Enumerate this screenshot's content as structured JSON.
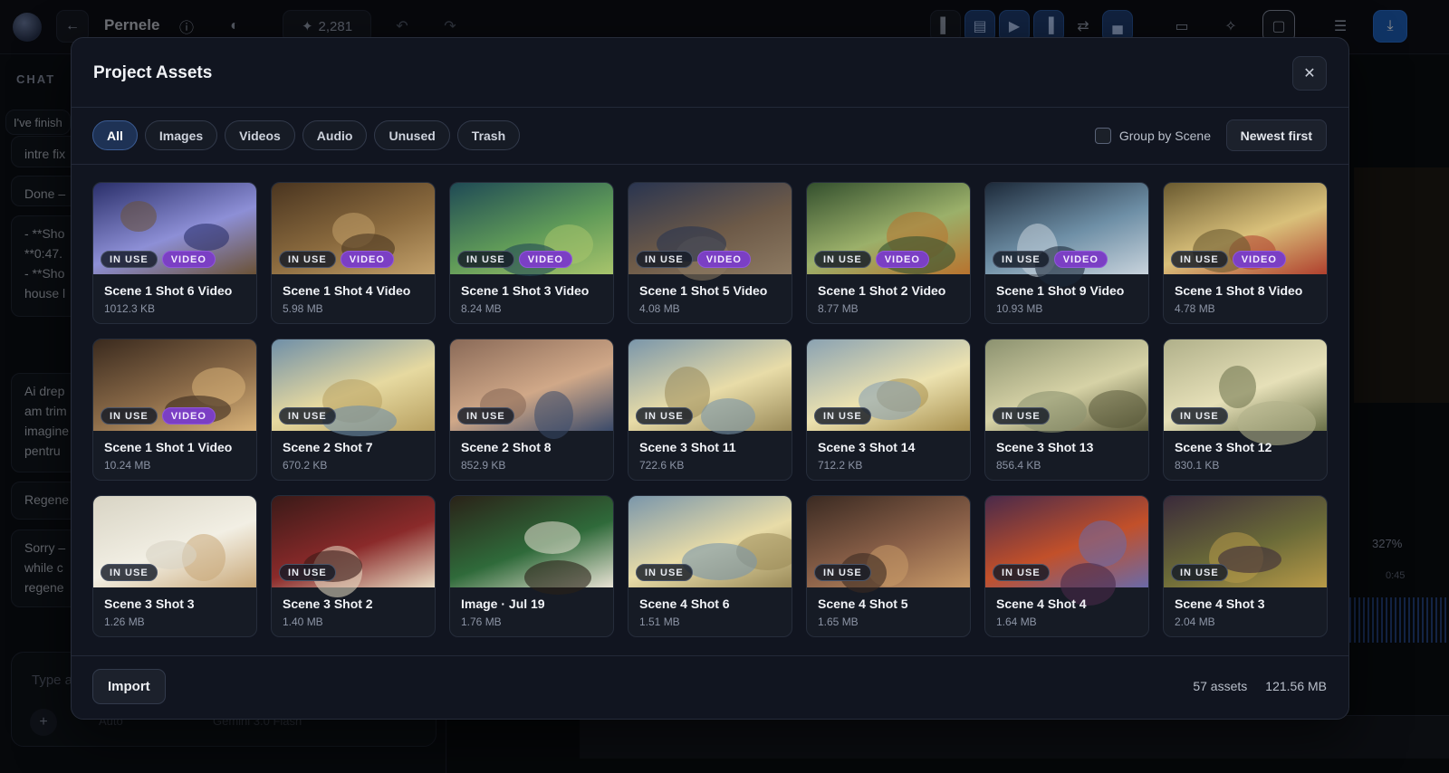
{
  "app": {
    "title": "Pernele",
    "credits": "2,281",
    "chat_label": "CHAT",
    "chat_messages": [
      "I've finish",
      "intre fix",
      "Done –",
      "- **Sho\n**0:47.\n- **Sho\nhouse l",
      "Ai drep\nam trim\nimagine\npentru",
      "Regene",
      "Sorry –\nwhile c\nregene"
    ],
    "chat_input_placeholder": "Type a",
    "model_label": "Gemini 3.0 Flash",
    "auto_label": "Auto",
    "zoom_label": "327%",
    "time_label": "0:45"
  },
  "modal": {
    "title": "Project Assets",
    "close_label": "✕",
    "filters": [
      "All",
      "Images",
      "Videos",
      "Audio",
      "Unused",
      "Trash"
    ],
    "active_filter": "All",
    "group_by_label": "Group by Scene",
    "sort_label": "Newest first",
    "import_label": "Import",
    "asset_count": "57 assets",
    "total_size": "121.56 MB",
    "badge_in_use": "IN USE",
    "badge_video": "VIDEO"
  },
  "assets": [
    {
      "name": "Scene 1 Shot 6 Video",
      "size": "1012.3 KB",
      "in_use": true,
      "video": true,
      "colors": [
        "#2a2f6a",
        "#8d8fd6",
        "#6b5236"
      ]
    },
    {
      "name": "Scene 1 Shot 4 Video",
      "size": "5.98 MB",
      "in_use": true,
      "video": true,
      "colors": [
        "#4a3520",
        "#8a6a3e",
        "#c2a06a"
      ]
    },
    {
      "name": "Scene 1 Shot 3 Video",
      "size": "8.24 MB",
      "in_use": true,
      "video": true,
      "colors": [
        "#1f4a55",
        "#5f9a58",
        "#a8c46c"
      ]
    },
    {
      "name": "Scene 1 Shot 5 Video",
      "size": "4.08 MB",
      "in_use": true,
      "video": true,
      "colors": [
        "#2a3550",
        "#6d5a48",
        "#8d7a62"
      ]
    },
    {
      "name": "Scene 1 Shot 2 Video",
      "size": "8.77 MB",
      "in_use": true,
      "video": true,
      "colors": [
        "#34502e",
        "#9bb06a",
        "#b8732e"
      ]
    },
    {
      "name": "Scene 1 Shot 9 Video",
      "size": "10.93 MB",
      "in_use": true,
      "video": true,
      "colors": [
        "#1d2a3a",
        "#6e8fa6",
        "#c8d3dc"
      ]
    },
    {
      "name": "Scene 1 Shot 8 Video",
      "size": "4.78 MB",
      "in_use": true,
      "video": true,
      "colors": [
        "#6a5a30",
        "#d9c07a",
        "#b0402e"
      ]
    },
    {
      "name": "Scene 1 Shot 1 Video",
      "size": "10.24 MB",
      "in_use": true,
      "video": true,
      "colors": [
        "#3a2a1e",
        "#8a6a48",
        "#d8b278"
      ]
    },
    {
      "name": "Scene 2 Shot 7",
      "size": "670.2 KB",
      "in_use": true,
      "video": false,
      "colors": [
        "#6f8fa8",
        "#e6d9a0",
        "#b8a060"
      ]
    },
    {
      "name": "Scene 2 Shot 8",
      "size": "852.9 KB",
      "in_use": true,
      "video": false,
      "colors": [
        "#8a6a58",
        "#d0a888",
        "#3a4a6a"
      ]
    },
    {
      "name": "Scene 3 Shot 11",
      "size": "722.6 KB",
      "in_use": true,
      "video": false,
      "colors": [
        "#7a96aa",
        "#e8dca8",
        "#9a8a58"
      ]
    },
    {
      "name": "Scene 3 Shot 14",
      "size": "712.2 KB",
      "in_use": true,
      "video": false,
      "colors": [
        "#8aa2b2",
        "#ece2b0",
        "#a8904e"
      ]
    },
    {
      "name": "Scene 3 Shot 13",
      "size": "856.4 KB",
      "in_use": true,
      "video": false,
      "colors": [
        "#8c9270",
        "#d6d2a6",
        "#5a5a3a"
      ]
    },
    {
      "name": "Scene 3 Shot 12",
      "size": "830.1 KB",
      "in_use": true,
      "video": false,
      "colors": [
        "#b0b08a",
        "#e6e0b8",
        "#6a7048"
      ]
    },
    {
      "name": "Scene 3 Shot 3",
      "size": "1.26 MB",
      "in_use": true,
      "video": false,
      "colors": [
        "#d8d4c4",
        "#f2efe4",
        "#c9a878"
      ]
    },
    {
      "name": "Scene 3 Shot 2",
      "size": "1.40 MB",
      "in_use": true,
      "video": false,
      "colors": [
        "#3a1a18",
        "#8a2a2a",
        "#e8dcc4"
      ]
    },
    {
      "name": "Image · Jul 19",
      "size": "1.76 MB",
      "in_use": false,
      "video": false,
      "colors": [
        "#2a2218",
        "#2f6a3a",
        "#e8e2d4"
      ]
    },
    {
      "name": "Scene 4 Shot 6",
      "size": "1.51 MB",
      "in_use": true,
      "video": false,
      "colors": [
        "#7a96aa",
        "#e8dca8",
        "#9a8a58"
      ]
    },
    {
      "name": "Scene 4 Shot 5",
      "size": "1.65 MB",
      "in_use": true,
      "video": false,
      "colors": [
        "#3a2a22",
        "#8a6048",
        "#c89a68"
      ]
    },
    {
      "name": "Scene 4 Shot 4",
      "size": "1.64 MB",
      "in_use": true,
      "video": false,
      "colors": [
        "#4a2a4a",
        "#c2502a",
        "#6a6aa8"
      ]
    },
    {
      "name": "Scene 4 Shot 3",
      "size": "2.04 MB",
      "in_use": true,
      "video": false,
      "colors": [
        "#3a2a3a",
        "#6a6a38",
        "#b89a48"
      ]
    }
  ]
}
